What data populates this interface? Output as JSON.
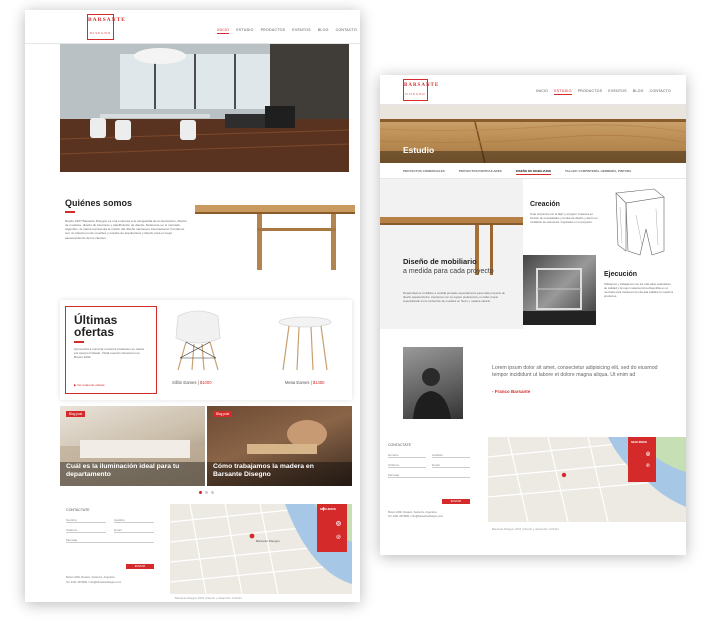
{
  "page_a": {
    "logo": {
      "title": "BARSANTE",
      "sub": "DISEGNO"
    },
    "nav": [
      "INICIO",
      "ESTUDIO",
      "PRODUCTOS",
      "EVENTOS",
      "BLOG",
      "CONTACTO"
    ],
    "about": {
      "title": "Quiénes somos",
      "text": "Desde 1967 Barsante Disegno es una empresa a la vanguardia de la decoración, diseño de muebles, diseño de interiores y planificación de diseño. Referente en el mercado argentino, la marca representa la misión del diseño nacional e internacional. Contamos con un showroom de muebles y estudio de arquitectura y diseño para el mejor asesoramiento de los clientes."
    },
    "offers": {
      "title_1": "Últimas",
      "title_2": "ofertas",
      "text": "Aprovechá a comprar nuestros productos en oferta por tiempo limitado. Visitá nuestro showroom en Brown 2292",
      "link": "Ver todas las ofertas",
      "products": [
        {
          "name": "Sillón Eames",
          "price": "$1000"
        },
        {
          "name": "Mesa Eames",
          "price": "$1450"
        }
      ]
    },
    "blog": [
      {
        "tag": "Blog post",
        "title": "Cuál es la iluminación ideal para tu departamento"
      },
      {
        "tag": "Blog post",
        "title": "Cómo trabajamos la madera en Barsante Disegno"
      }
    ],
    "contact": {
      "title": "CONTACTATE",
      "fields": [
        "Nombre",
        "Apellido",
        "Teléfono",
        "Email",
        "Mensaje"
      ],
      "button": "ENVIAR",
      "address_1": "Brown 2292, Rosario, Santa Fe, Argentina",
      "address_2": "Tel: 0341 4379991 / info@barsantedisegno.com"
    },
    "social_label": "SEGUINOS",
    "footer": "Barsante Disegno 2016 | Diseño y desarrollo: Inclimbr",
    "map_label": "Barsante Disegno"
  },
  "page_b": {
    "logo": {
      "title": "BARSANTE",
      "sub": "DISEGNO"
    },
    "nav": [
      "INICIO",
      "ESTUDIO",
      "PRODUCTOS",
      "EVENTOS",
      "BLOG",
      "CONTACTO"
    ],
    "hero_title": "Estudio",
    "tabs": [
      "PROYECTOS COMERCIALES",
      "PROYECTOS PARTICULARES",
      "DISEÑO DE MOBILIARIO",
      "TALLER: CARPINTERÍA, HERRERÍA, PINTURA"
    ],
    "creacion": {
      "title": "Creación",
      "text": "Todo comienza con el lápiz y el papel. Creamos en función de necesidades y la idea de diseño y dentro el mobiliario de estructura. Inspirados en el proyecto."
    },
    "diseno": {
      "title": "Diseño de mobiliario",
      "subtitle": "a medida para cada proyecto",
      "text": "Desarrollamos mobiliario a medida pensado especialmente para cada proyecto de diseño arquitectónico. Contamos con un equipo profesional y un taller propio especializado en la confección de muebles en hierro y madera natural."
    },
    "ejecucion": {
      "title": "Ejecución",
      "text": "Utilizamos y trabajamos con los más altos estándares de calidad y la mejor materia prima disponible en el mercado para mantener la más alta calidad en nuestros productos."
    },
    "quote": {
      "text": "Lorem ipsum dolor sit amet, consectetur adipisicing elit, sed do eiusmod tempor incididunt ut labore et dolore magna aliqua. Ut enim ad",
      "author": "- Franco Barsante"
    },
    "contact": {
      "title": "CONTACTATE",
      "fields": [
        "Nombre",
        "Apellido",
        "Teléfono",
        "Email",
        "Mensaje"
      ],
      "button": "ENVIAR",
      "address_1": "Brown 2292, Rosario, Santa Fe, Argentina",
      "address_2": "Tel: 0341 4379991 / info@barsantedisegno.com"
    },
    "social_label": "SEGUINOS",
    "footer": "Barsante Disegno 2016 | Diseño y desarrollo: Inclimbr"
  },
  "colors": {
    "accent": "#d42a2a",
    "wood": "#c89a60",
    "dark": "#222222"
  }
}
